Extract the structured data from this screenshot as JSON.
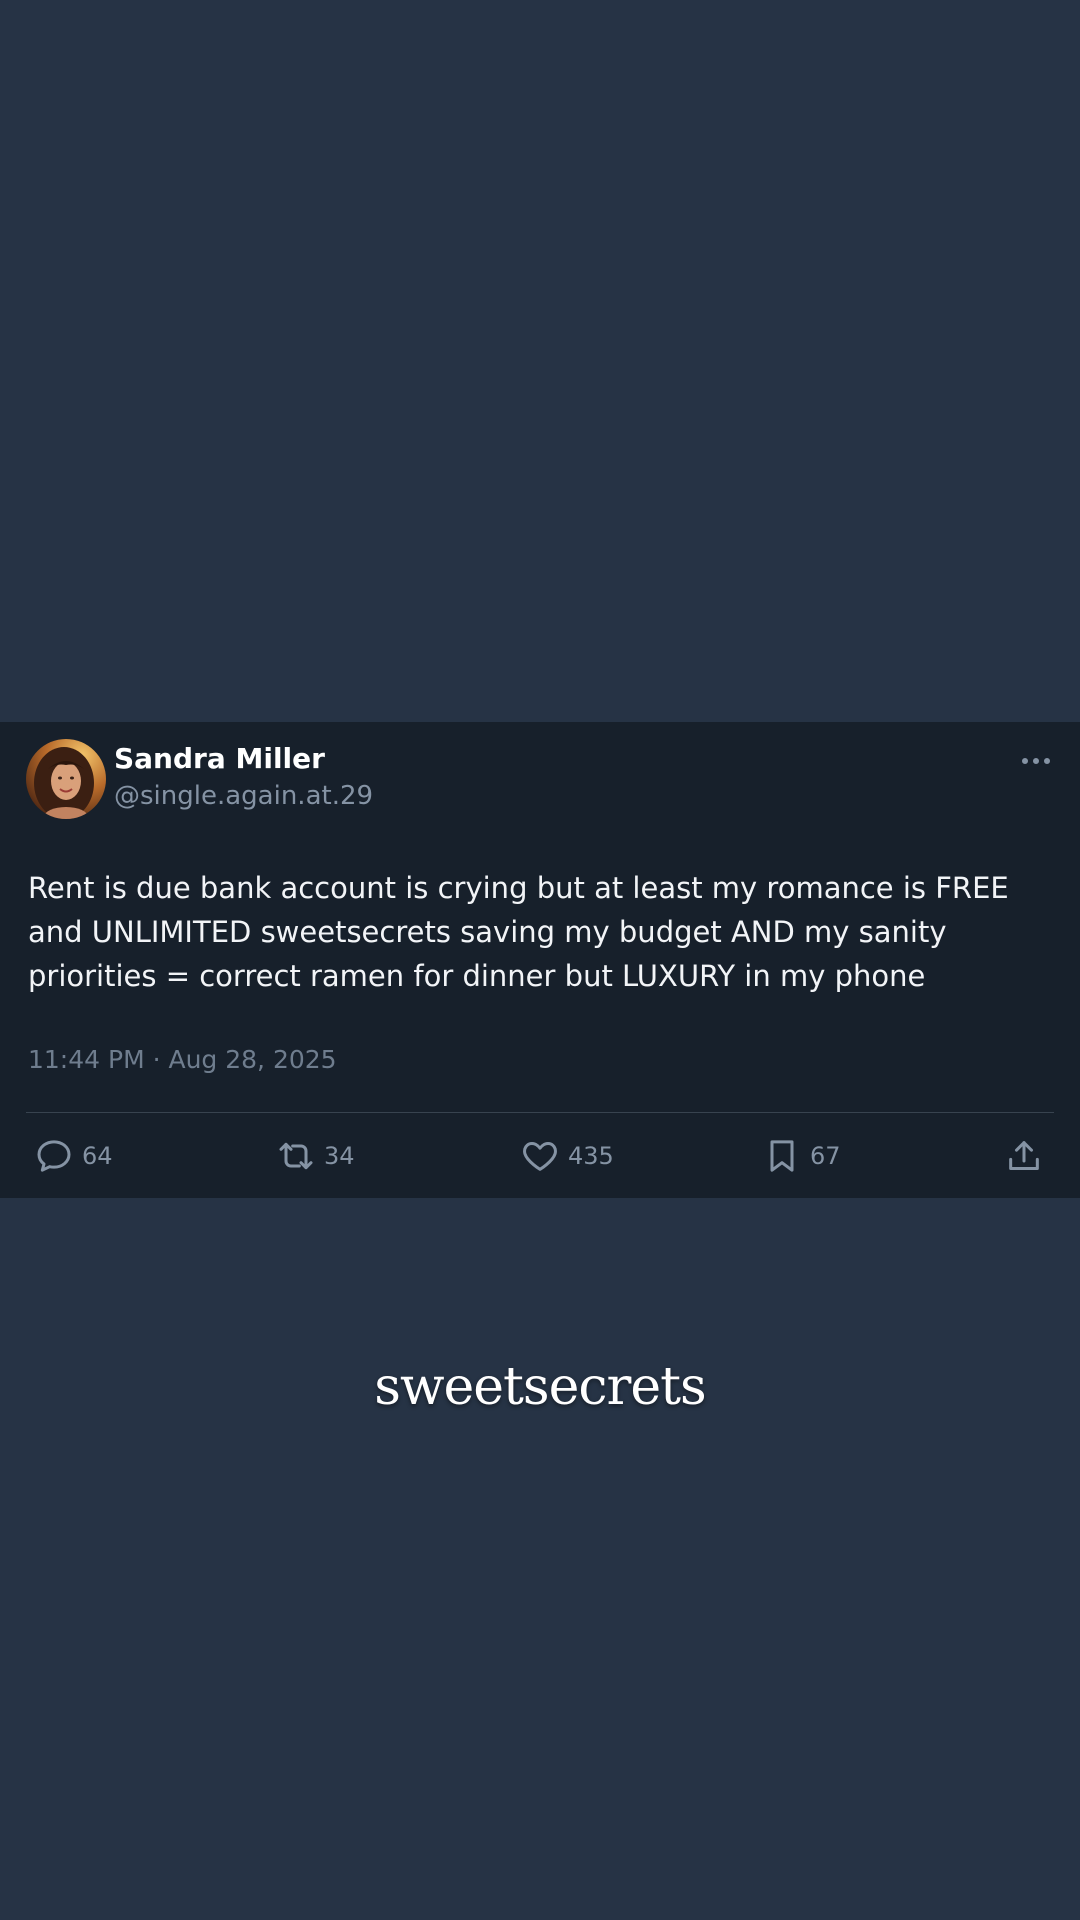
{
  "post": {
    "author": {
      "display_name": "Sandra Miller",
      "handle": "@single.again.at.29"
    },
    "text": "Rent is due bank account is crying but at least my romance is FREE and UNLIMITED sweetsecrets saving my budget AND my sanity priorities = correct ramen for dinner but LUXURY in my phone",
    "timestamp": "11:44 PM · Aug 28, 2025",
    "actions": {
      "replies": "64",
      "reposts": "34",
      "likes": "435",
      "bookmarks": "67"
    }
  },
  "brand": {
    "logo_text": "sweetsecrets"
  },
  "colors": {
    "background": "#263345",
    "card": "#17202b",
    "muted_text": "#8593a4"
  },
  "icons": [
    "more-icon",
    "reply-icon",
    "repost-icon",
    "like-icon",
    "bookmark-icon",
    "share-icon"
  ]
}
